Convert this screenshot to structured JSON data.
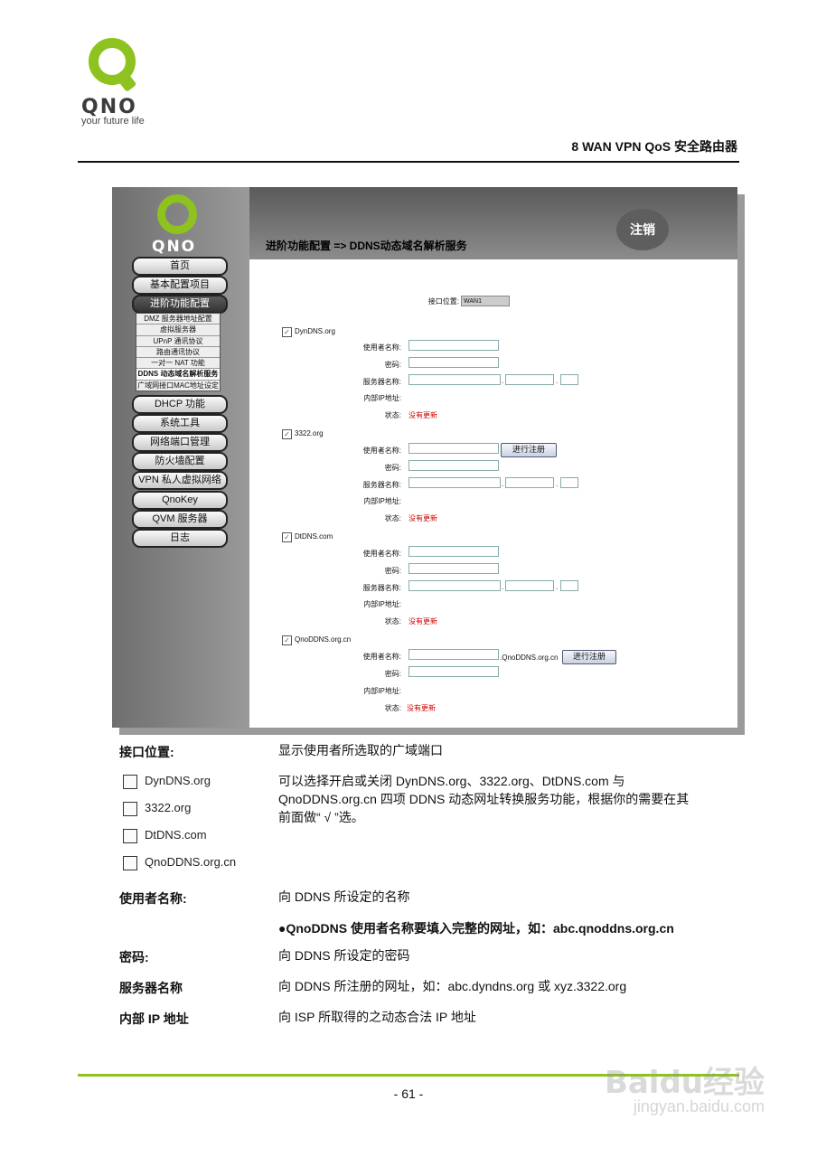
{
  "header": {
    "brand": "QNO",
    "tagline": "your future life",
    "title": "8 WAN VPN QoS 安全路由器"
  },
  "shot": {
    "logo_word": "QNO",
    "logout": "注销",
    "heading": "进阶功能配置 => DDNS动态域名解析服务",
    "nav": [
      "首页",
      "基本配置项目",
      "进阶功能配置",
      "DHCP 功能",
      "系统工具",
      "网络端口管理",
      "防火墙配置",
      "VPN 私人虚拟网络",
      "QnoKey",
      "QVM 服务器",
      "日志"
    ],
    "subnav": [
      "DMZ 服务器地址配置",
      "虚拟服务器",
      "UPnP 通讯协议",
      "路由通讯协议",
      "一对一 NAT 功能",
      "DDNS 动态域名解析服务",
      "广域网接口MAC地址设定"
    ],
    "interface_label": "接口位置:",
    "interface_value": "WAN1",
    "field_user": "使用者名称:",
    "field_pass": "密码:",
    "field_server": "服务器名称:",
    "field_ip": "内部IP地址:",
    "field_status": "状态:",
    "status_value": "没有更新",
    "register_btn": "进行注册",
    "qno_suffix": ".QnoDDNS.org.cn",
    "dot": ".",
    "check_mark": "✓",
    "services": [
      "DynDNS.org",
      "3322.org",
      "DtDNS.com",
      "QnoDDNS.org.cn"
    ]
  },
  "doc": {
    "interface_label": "接口位置:",
    "interface_desc": "显示使用者所选取的广域端口",
    "checkboxes": [
      "DynDNS.org",
      "3322.org",
      "DtDNS.com",
      "QnoDDNS.org.cn"
    ],
    "checkbox_desc_1": "可以选择开启或关闭 DynDNS.org、3322.org、DtDNS.com 与",
    "checkbox_desc_2": "QnoDDNS.org.cn 四项 DDNS 动态网址转换服务功能，根据你的需要在其",
    "checkbox_desc_3": "前面做“ √ ”选。",
    "user_label": "使用者名称:",
    "user_desc": "向 DDNS 所设定的名称",
    "user_note": "●QnoDDNS 使用者名称要填入完整的网址，如：abc.qnoddns.org.cn",
    "pass_label": "密码:",
    "pass_desc": "向 DDNS 所设定的密码",
    "server_label": "服务器名称",
    "server_desc": "向 DDNS 所注册的网址，如：abc.dyndns.org 或 xyz.3322.org",
    "ip_label": "内部 IP 地址",
    "ip_desc": "向 ISP 所取得的之动态合法 IP 地址"
  },
  "footer": {
    "page": "- 61 -",
    "watermark": "Baidu经验",
    "watermark_url": "jingyan.baidu.com"
  },
  "colors": {
    "brand_green": "#8dc21f",
    "status_red": "#cc0000"
  }
}
